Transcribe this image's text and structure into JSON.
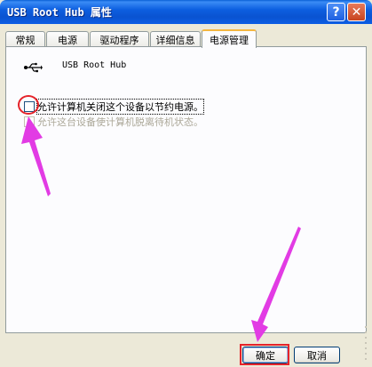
{
  "window": {
    "title": "USB Root Hub 属性",
    "help_glyph": "?",
    "close_glyph": "✕"
  },
  "tabs": [
    {
      "label": "常规"
    },
    {
      "label": "电源"
    },
    {
      "label": "驱动程序"
    },
    {
      "label": "详细信息"
    },
    {
      "label": "电源管理",
      "active": true
    }
  ],
  "device": {
    "icon": "usb-icon",
    "name": "USB Root Hub"
  },
  "options": [
    {
      "label": "允许计算机关闭这个设备以节约电源。",
      "checked": false,
      "enabled": true
    },
    {
      "label": "允许这台设备使计算机脱离待机状态。",
      "checked": false,
      "enabled": false
    }
  ],
  "buttons": {
    "ok": "确定",
    "cancel": "取消"
  },
  "annotation_colors": {
    "circle": "#e5232a",
    "arrow": "#e23be4"
  }
}
